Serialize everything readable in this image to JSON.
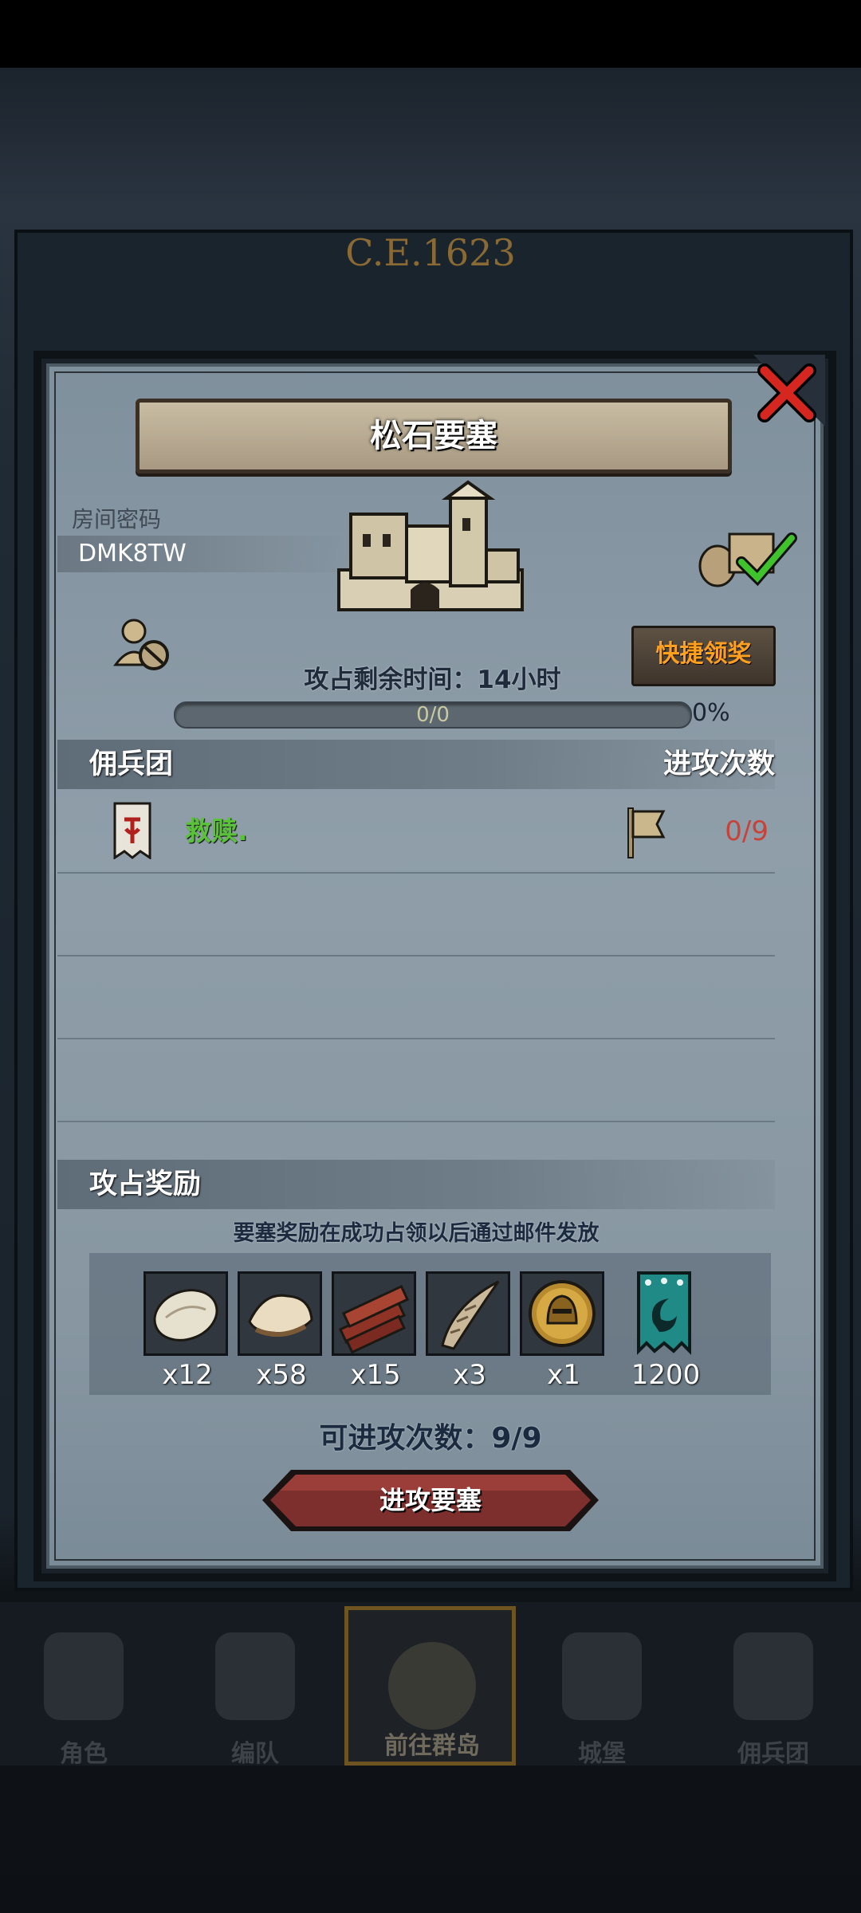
{
  "background": {
    "era": "C.E.1623"
  },
  "navbar": {
    "items": [
      {
        "label": "角色",
        "icon": "knight-icon"
      },
      {
        "label": "编队",
        "icon": "helmet-group-icon"
      },
      {
        "label": "前往群岛",
        "icon": "globe-icon"
      },
      {
        "label": "城堡",
        "icon": "castle-icon"
      },
      {
        "label": "佣兵团",
        "icon": "mercenary-icon"
      }
    ],
    "active_index": 2
  },
  "dialog": {
    "title": "松石要塞",
    "room": {
      "label": "房间密码",
      "code": "DMK8TW"
    },
    "quick_claim": "快捷领奖",
    "timer_text": "攻占剩余时间：14小时",
    "progress": {
      "text": "0/0",
      "percent": "0%",
      "fraction": 0
    },
    "mercenary_header": "佣兵团",
    "attack_count_header": "进攻次数",
    "rows": [
      {
        "name": "救赎.",
        "count": "0/9"
      }
    ],
    "rewards_header": "攻占奖励",
    "rewards_note": "要塞奖励在成功占领以后通过邮件发放",
    "rewards": [
      {
        "icon": "fur-pelt-icon",
        "qty": "x12"
      },
      {
        "icon": "hide-icon",
        "qty": "x58"
      },
      {
        "icon": "wood-planks-icon",
        "qty": "x15"
      },
      {
        "icon": "horn-icon",
        "qty": "x3"
      },
      {
        "icon": "golden-helmet-medal-icon",
        "qty": "x1"
      },
      {
        "icon": "teal-banner-icon",
        "qty": "1200"
      }
    ],
    "attacks_left": "可进攻次数：9/9",
    "attack_button": "进攻要塞"
  },
  "colors": {
    "accent_orange": "#ffa020",
    "name_green": "#5ac238",
    "count_red": "#c8423a"
  }
}
